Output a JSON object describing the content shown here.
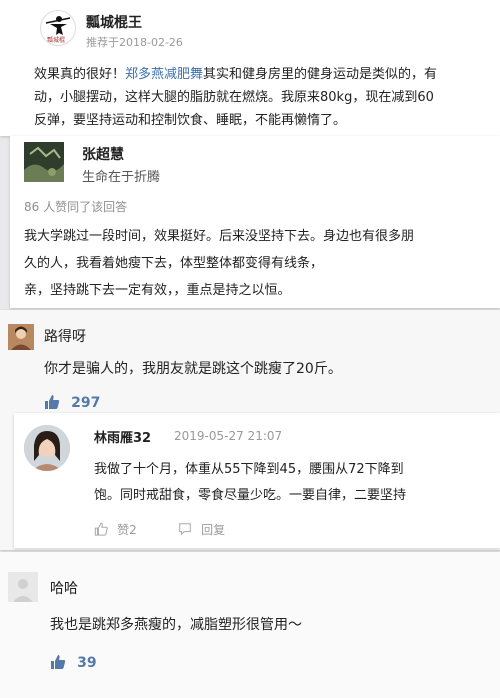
{
  "post1": {
    "author": "瓢城棍王",
    "date": "推荐于2018-02-26",
    "text_before": "效果真的很好！",
    "text_link": "郑多燕减肥舞",
    "text_after": "其实和健身房里的健身运动是类似的，有",
    "line2": "动，小腿摆动，这样大腿的脂肪就在燃烧。我原来80kg，现在减到60",
    "line3": "反弹，要坚持运动和控制饮食、睡眠，不能再懒惰了。"
  },
  "post2": {
    "author": "张超慧",
    "subtitle": "生命在于折腾",
    "likes_line": "86 人赞同了该回答",
    "line1": "我大学跳过一段时间，效果挺好。后来没坚持下去。身边也有很多朋",
    "line2": "久的人，我看着她瘦下去，体型整体都变得有线条，",
    "line3": "亲，坚持跳下去一定有效，，重点是持之以恒。"
  },
  "post3": {
    "author": "路得呀",
    "text": "你才是骗人的，我朋友就是跳这个跳瘦了20斤。",
    "likes": "297"
  },
  "post4": {
    "author": "林雨雁32",
    "datetime": "2019-05-27 21:07",
    "line1": "我做了十个月，体重从55下降到45，腰围从72下降到",
    "line2": "饱。同时戒甜食，零食尽量少吃。一要自律，二要坚持",
    "like_label": "赞2",
    "reply_label": "回复"
  },
  "post5": {
    "author": "哈哈",
    "text": "我也是跳郑多燕瘦的，减脂塑形很管用～",
    "likes": "39"
  }
}
